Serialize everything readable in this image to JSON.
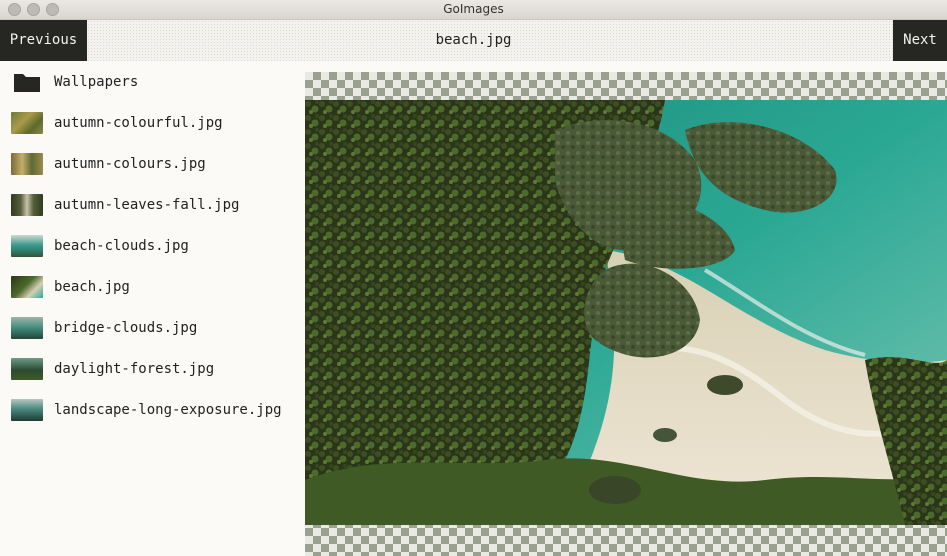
{
  "window": {
    "title": "GoImages"
  },
  "toolbar": {
    "previous_label": "Previous",
    "next_label": "Next",
    "current_file": "beach.jpg"
  },
  "sidebar": {
    "folder": {
      "label": "Wallpapers",
      "icon": "folder-icon"
    },
    "items": [
      {
        "label": "autumn-colourful.jpg",
        "thumb": "autumn"
      },
      {
        "label": "autumn-colours.jpg",
        "thumb": "autumn"
      },
      {
        "label": "autumn-leaves-fall.jpg",
        "thumb": "forest-path"
      },
      {
        "label": "beach-clouds.jpg",
        "thumb": "teal"
      },
      {
        "label": "beach.jpg",
        "thumb": "beach"
      },
      {
        "label": "bridge-clouds.jpg",
        "thumb": "teal"
      },
      {
        "label": "daylight-forest.jpg",
        "thumb": "forest"
      },
      {
        "label": "landscape-long-exposure.jpg",
        "thumb": "landscape"
      }
    ]
  },
  "viewer": {
    "image_subject": "beach"
  },
  "colors": {
    "button_bg": "#262622",
    "button_text": "#f2f2ee",
    "checker": "#9aa190",
    "sea": "#2aa894",
    "sand": "#e6dcc4",
    "foliage_dark": "#2b3519",
    "foliage": "#4c6a2c"
  }
}
